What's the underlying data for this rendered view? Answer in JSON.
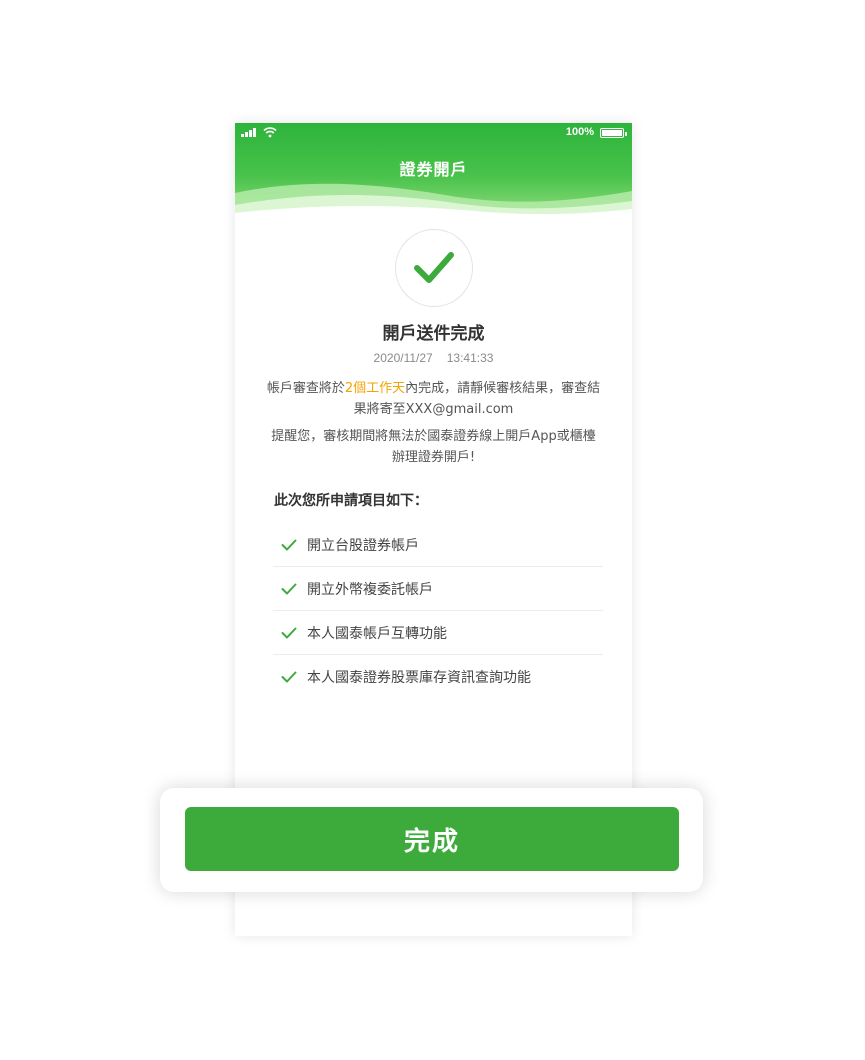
{
  "status_bar": {
    "battery": "100%"
  },
  "header": {
    "title": "證券開戶"
  },
  "result": {
    "title": "開戶送件完成",
    "date": "2020/11/27",
    "time": "13:41:33",
    "message_before": "帳戶審查將於",
    "message_highlight": "2個工作天",
    "message_after": "內完成，請靜候審核結果，審查結果將寄至XXX@gmail.com",
    "reminder": "提醒您，審核期間將無法於國泰證券線上開戶App或櫃檯辦理證券開戶!"
  },
  "applied": {
    "title": "此次您所申請項目如下：",
    "items": [
      {
        "label": "開立台股證券帳戶"
      },
      {
        "label": "開立外幣複委託帳戶"
      },
      {
        "label": "本人國泰帳戶互轉功能"
      },
      {
        "label": "本人國泰證券股票庫存資訊查詢功能"
      }
    ]
  },
  "footer": {
    "done_label": "完成"
  },
  "colors": {
    "brand_green": "#3daa3c",
    "highlight": "#f5a300"
  },
  "icons": {
    "success": "check-icon",
    "item": "check-icon"
  }
}
